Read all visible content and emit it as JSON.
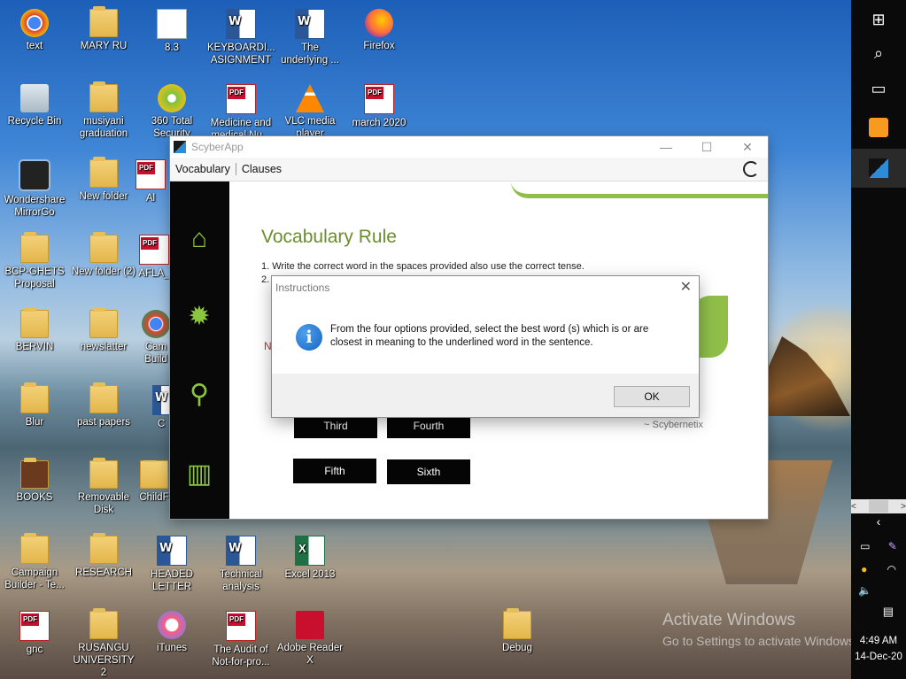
{
  "desktop": {
    "icons": [
      {
        "label": "text",
        "icon": "chrome-icon"
      },
      {
        "label": "MARY RU",
        "icon": "folder-icon"
      },
      {
        "label": "8.3",
        "icon": "document-icon"
      },
      {
        "label": "KEYBOARDI... ASIGNMENT",
        "icon": "word-icon"
      },
      {
        "label": "The underlying ...",
        "icon": "word-icon"
      },
      {
        "label": "Firefox",
        "icon": "firefox-icon"
      },
      {
        "label": "Recycle Bin",
        "icon": "recycle-bin-icon"
      },
      {
        "label": "musiyani graduation",
        "icon": "folder-icon"
      },
      {
        "label": "360 Total Security",
        "icon": "shield-icon"
      },
      {
        "label": "Medicine and medical Nu...",
        "icon": "pdf-icon"
      },
      {
        "label": "VLC media player",
        "icon": "vlc-icon"
      },
      {
        "label": "march 2020",
        "icon": "pdf-icon"
      },
      {
        "label": "Wondershare MirrorGo",
        "icon": "phone-icon"
      },
      {
        "label": "New folder",
        "icon": "folder-icon"
      },
      {
        "label": "Al",
        "icon": "pdf-icon"
      },
      {
        "label": "BCP-GHETS Proposal",
        "icon": "folder-icon"
      },
      {
        "label": "New folder (2)",
        "icon": "folder-icon"
      },
      {
        "label": "AFLA_",
        "icon": "pdf-icon"
      },
      {
        "label": "BERVIN",
        "icon": "folder-icon"
      },
      {
        "label": "newslatter",
        "icon": "folder-icon"
      },
      {
        "label": "Cam Build",
        "icon": "chrome-icon"
      },
      {
        "label": "Blur",
        "icon": "folder-icon"
      },
      {
        "label": "past papers",
        "icon": "folder-icon"
      },
      {
        "label": "C",
        "icon": "word-icon"
      },
      {
        "label": "BOOKS",
        "icon": "folder-icon"
      },
      {
        "label": "Removable Disk",
        "icon": "folder-icon"
      },
      {
        "label": "ChildF",
        "icon": "folder-icon"
      },
      {
        "label": "Campaign Builder - Te...",
        "icon": "folder-icon"
      },
      {
        "label": "RESEARCH",
        "icon": "folder-icon"
      },
      {
        "label": "HEADED LETTER",
        "icon": "word-icon"
      },
      {
        "label": "Technical analysis",
        "icon": "word-icon"
      },
      {
        "label": "Excel 2013",
        "icon": "excel-icon"
      },
      {
        "label": "gnc",
        "icon": "pdf-icon"
      },
      {
        "label": "RUSANGU UNIVERSITY 2",
        "icon": "folder-icon"
      },
      {
        "label": "iTunes",
        "icon": "itunes-icon"
      },
      {
        "label": "The Audit of Not-for-pro...",
        "icon": "pdf-icon"
      },
      {
        "label": "Adobe Reader X",
        "icon": "adobe-reader-icon"
      },
      {
        "label": "Debug",
        "icon": "folder-icon"
      }
    ],
    "watermark": {
      "line1": "Activate Windows",
      "line2": "Go to Settings to activate Windows."
    }
  },
  "taskbar": {
    "time": "4:49 AM",
    "date": "14-Dec-20"
  },
  "app": {
    "title": "ScyberApp",
    "menu": [
      "Vocabulary",
      "Clauses"
    ],
    "heading": "Vocabulary Rule",
    "rules": [
      "1. Write the correct word in the spaces provided also use the correct tense.",
      "2."
    ],
    "red_text": "N",
    "signature": "~ Scybernetix",
    "options": [
      "Third",
      "Fourth",
      "Fifth",
      "Sixth"
    ]
  },
  "dialog": {
    "title": "Instructions",
    "message": "From the four options provided, select the  best word (s) which is or are closest in meaning to the underlined word in the sentence.",
    "ok_label": "OK"
  },
  "colors": {
    "accent_green": "#8cc63f",
    "info_blue": "#1565c0"
  }
}
